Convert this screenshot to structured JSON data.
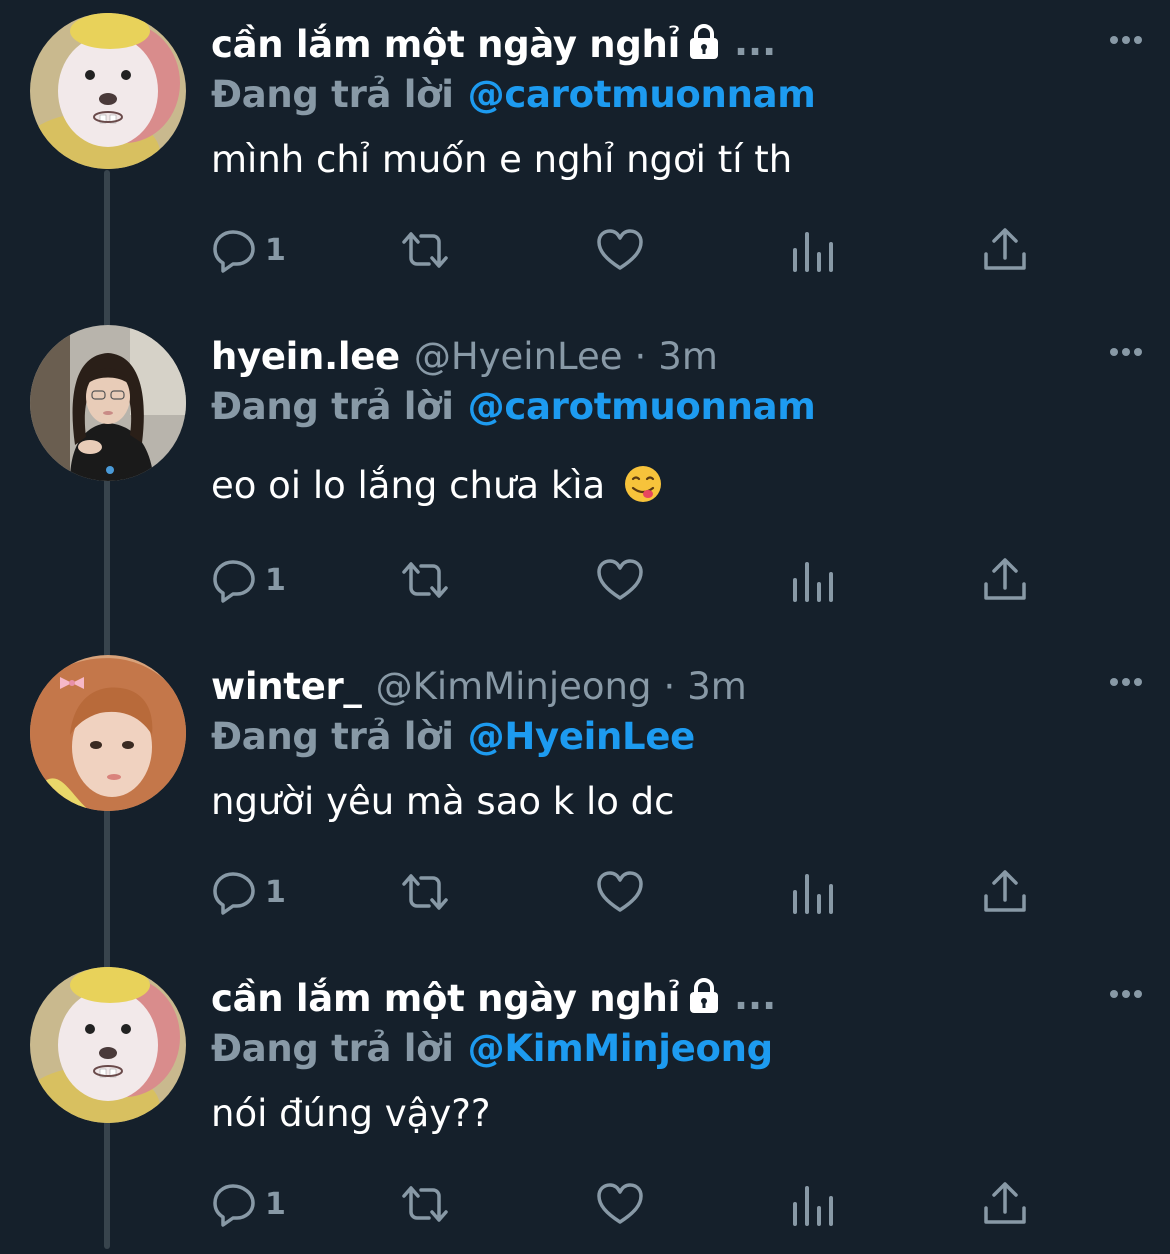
{
  "tweets": [
    {
      "display_name": "cần lắm một ngày nghỉ",
      "protected": true,
      "handle": "",
      "time": "",
      "truncated_marker": "...",
      "reply_label": "Đang trả lời",
      "reply_to": "@carotmuonnam",
      "text": "mình chỉ muốn e nghỉ ngơi tí th",
      "reply_count": "1",
      "avatar_icon": "cartoon-character-avatar"
    },
    {
      "display_name": "hyein.lee",
      "protected": false,
      "handle": "@HyeinLee",
      "dot": "·",
      "time": "3m",
      "reply_label": "Đang trả lời",
      "reply_to": "@carotmuonnam",
      "text": "eo oi lo lắng chưa kìa",
      "emoji": "face-savoring-food-emoji",
      "reply_count": "1",
      "avatar_icon": "girl-photo-avatar"
    },
    {
      "display_name": "winter_",
      "protected": false,
      "handle": "@KimMinjeong",
      "dot": "·",
      "time": "3m",
      "reply_label": "Đang trả lời",
      "reply_to": "@HyeinLee",
      "text": "người yêu mà sao k lo dc",
      "reply_count": "1",
      "avatar_icon": "girl-with-bow-avatar"
    },
    {
      "display_name": "cần lắm một ngày nghỉ",
      "protected": true,
      "handle": "",
      "time": "",
      "truncated_marker": "...",
      "reply_label": "Đang trả lời",
      "reply_to": "@KimMinjeong",
      "text": "nói đúng vậy??",
      "reply_count": "1",
      "avatar_icon": "cartoon-character-avatar"
    }
  ],
  "colors": {
    "background": "#15202b",
    "secondary_text": "#8899a6",
    "link": "#1d9bf0",
    "thread_line": "#38444d"
  }
}
